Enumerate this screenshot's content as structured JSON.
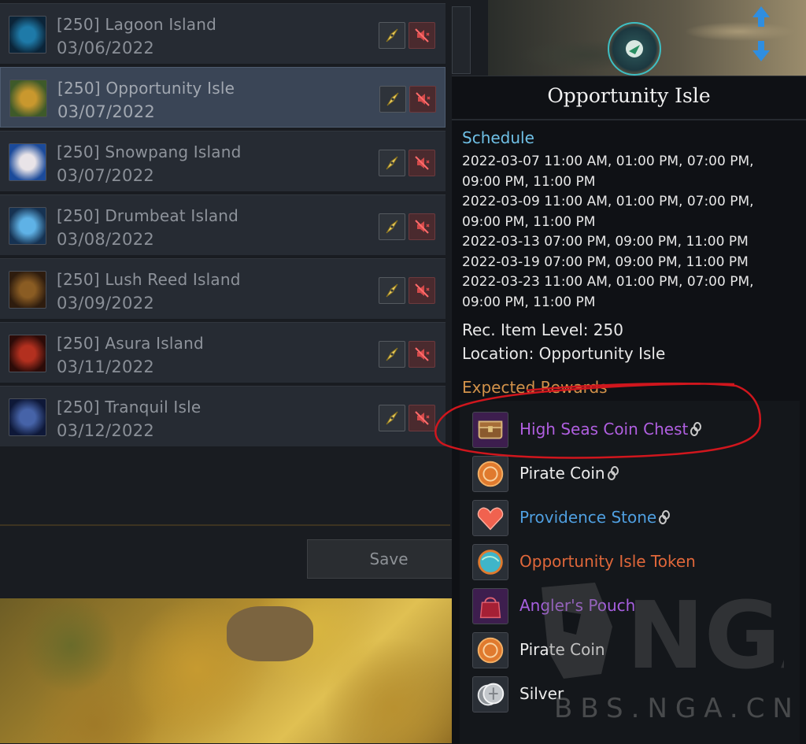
{
  "islands": [
    {
      "name": "[250] Lagoon Island",
      "date": "03/06/2022",
      "thumb": "lagoon-thumb",
      "color_a": "#1e7aa8",
      "color_b": "#0b2438",
      "selected": false
    },
    {
      "name": "[250] Opportunity Isle",
      "date": "03/07/2022",
      "thumb": "opportunity-thumb",
      "color_a": "#c9982e",
      "color_b": "#3e5a2a",
      "selected": true
    },
    {
      "name": "[250] Snowpang Island",
      "date": "03/07/2022",
      "thumb": "snowpang-thumb",
      "color_a": "#e9e4e8",
      "color_b": "#1b4a9a",
      "selected": false
    },
    {
      "name": "[250] Drumbeat Island",
      "date": "03/08/2022",
      "thumb": "drumbeat-thumb",
      "color_a": "#5fb2e6",
      "color_b": "#163252",
      "selected": false
    },
    {
      "name": "[250] Lush Reed Island",
      "date": "03/09/2022",
      "thumb": "lush-reed-thumb",
      "color_a": "#8a5c23",
      "color_b": "#2e1c0e",
      "selected": false
    },
    {
      "name": "[250] Asura Island",
      "date": "03/11/2022",
      "thumb": "asura-thumb",
      "color_a": "#b3301f",
      "color_b": "#2c0b08",
      "selected": false
    },
    {
      "name": "[250] Tranquil Isle",
      "date": "03/12/2022",
      "thumb": "tranquil-thumb",
      "color_a": "#4663a8",
      "color_b": "#0e1838",
      "selected": false
    }
  ],
  "save_label": "Save",
  "tooltip": {
    "title": "Opportunity Isle",
    "schedule_label": "Schedule",
    "schedule_lines": [
      "2022-03-07 11:00 AM, 01:00 PM, 07:00 PM,",
      "09:00 PM, 11:00 PM",
      "2022-03-09 11:00 AM, 01:00 PM, 07:00 PM,",
      "09:00 PM, 11:00 PM",
      "2022-03-13 07:00 PM, 09:00 PM, 11:00 PM",
      "2022-03-19 07:00 PM, 09:00 PM, 11:00 PM",
      "2022-03-23 11:00 AM, 01:00 PM, 07:00 PM,",
      "09:00 PM, 11:00 PM"
    ],
    "rec_item_level": "Rec. Item Level: 250",
    "location": "Location: Opportunity Isle",
    "rewards_label": "Expected Rewards",
    "rewards": [
      {
        "name": "High Seas Coin Chest",
        "color": "#b05fe0",
        "icon": "chest-icon",
        "bound": true
      },
      {
        "name": "Pirate Coin",
        "color": "#ececec",
        "icon": "pirate-coin-icon",
        "bound": true
      },
      {
        "name": "Providence Stone",
        "color": "#4f9fe0",
        "icon": "heart-stone-icon",
        "bound": true
      },
      {
        "name": "Opportunity Isle Token",
        "color": "#e0673a",
        "icon": "orb-token-icon",
        "bound": false
      },
      {
        "name": "Angler's Pouch",
        "color": "#a75fe0",
        "icon": "pouch-icon",
        "bound": false
      },
      {
        "name": "Pirate Coin",
        "color": "#ececec",
        "icon": "pirate-coin-icon",
        "bound": false
      },
      {
        "name": "Silver",
        "color": "#ececec",
        "icon": "silver-icon",
        "bound": false
      }
    ]
  },
  "watermark": {
    "text": "BBS.NGA.CN",
    "logo": "NGA"
  },
  "colors": {
    "highlight_circle": "#d0161d",
    "schedule": "#6fc0e6",
    "rewards_header": "#d2924a"
  }
}
